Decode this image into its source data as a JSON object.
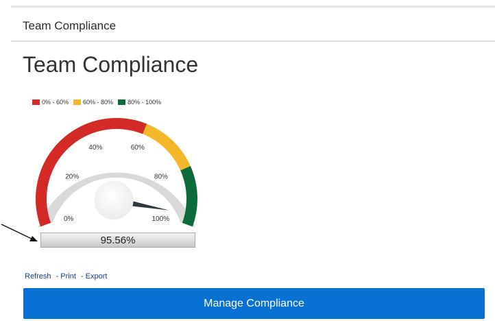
{
  "header": {
    "title": "Team Compliance"
  },
  "page": {
    "title": "Team Compliance"
  },
  "gauge": {
    "legend": [
      {
        "label": "0% - 60%",
        "color": "#d42a27"
      },
      {
        "label": "60% - 80%",
        "color": "#f4b72a"
      },
      {
        "label": "80% - 100%",
        "color": "#0b6b3a"
      }
    ],
    "ticks": [
      {
        "value": 0,
        "label": "0%"
      },
      {
        "value": 20,
        "label": "20%"
      },
      {
        "value": 40,
        "label": "40%"
      },
      {
        "value": 60,
        "label": "60%"
      },
      {
        "value": 80,
        "label": "80%"
      },
      {
        "value": 100,
        "label": "100%"
      }
    ],
    "min": 0,
    "max": 100,
    "value": 95.56,
    "readout": "95.56%"
  },
  "actions": {
    "refresh": "Refresh",
    "print": "Print",
    "export": "Export",
    "separator": "-"
  },
  "manage_button": "Manage Compliance"
}
